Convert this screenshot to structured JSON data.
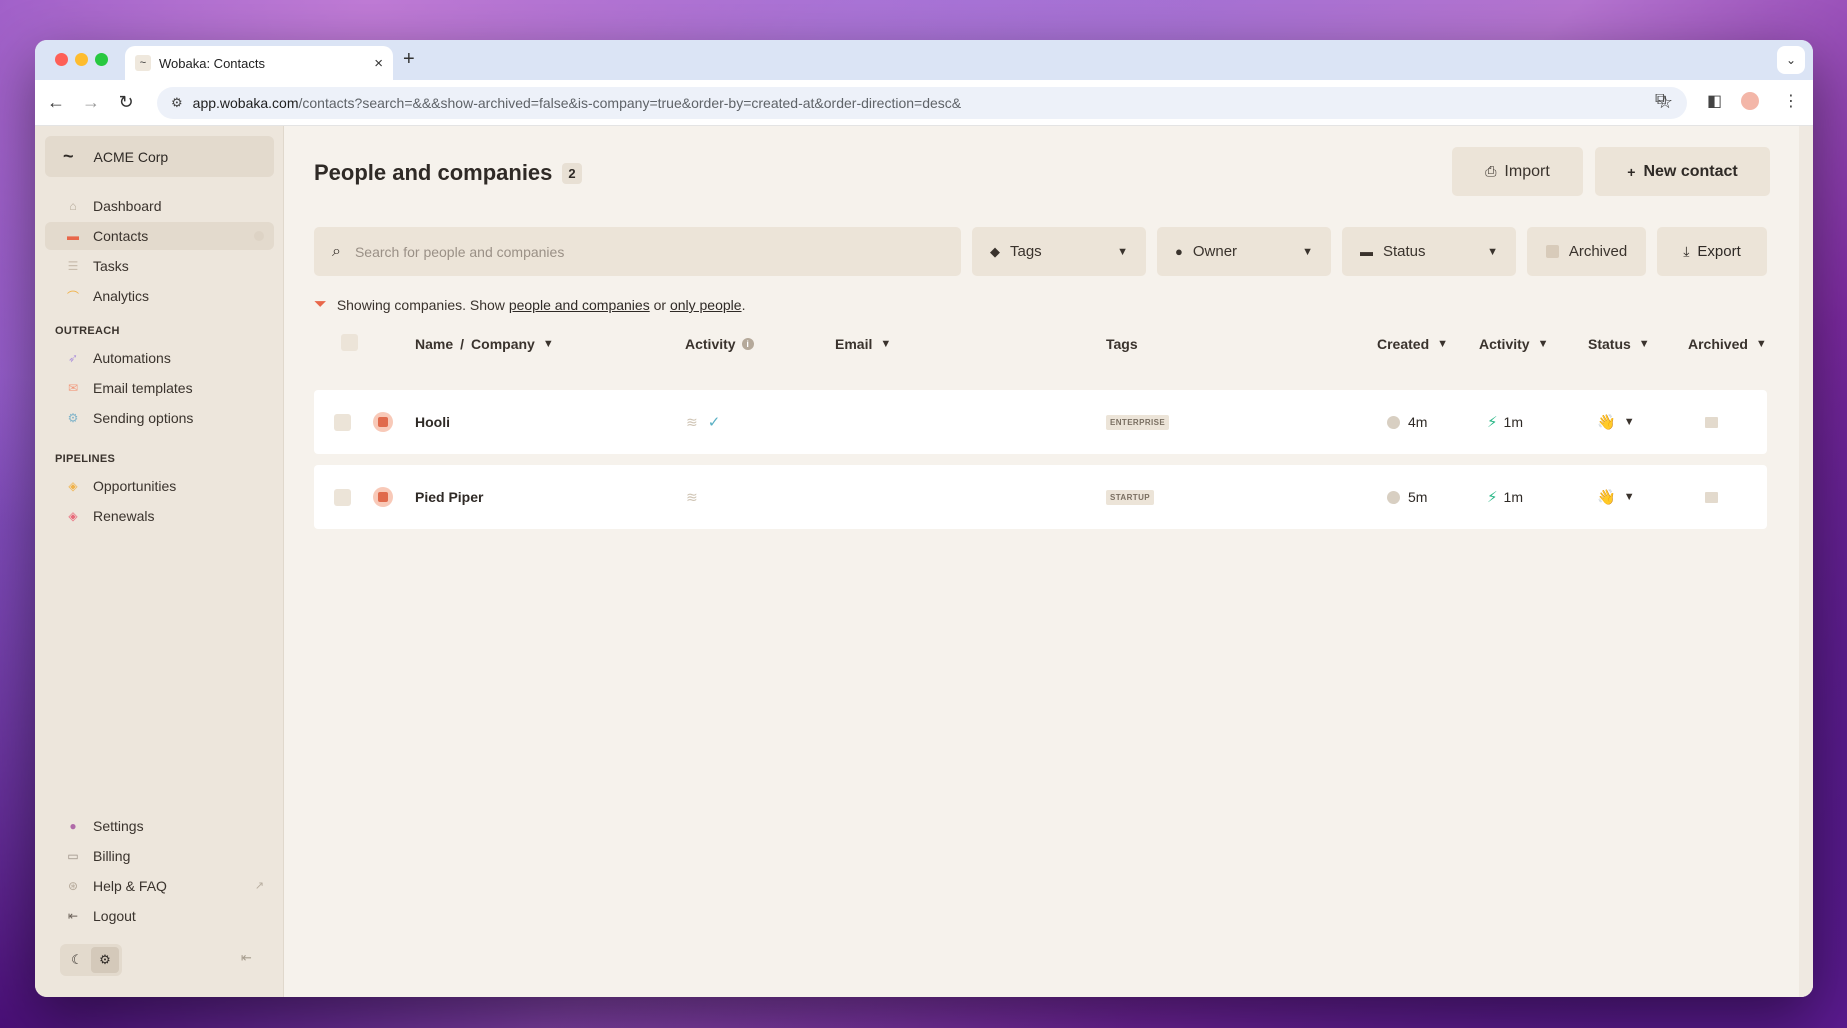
{
  "browser": {
    "tab_title": "Wobaka: Contacts",
    "url_host": "app.wobaka.com",
    "url_path": "/contacts?search=&&&show-archived=false&is-company=true&order-by=created-at&order-direction=desc&"
  },
  "sidebar": {
    "workspace": "ACME Corp",
    "main_items": [
      {
        "label": "Dashboard",
        "icon": "home-icon"
      },
      {
        "label": "Contacts",
        "icon": "contact-card-icon"
      },
      {
        "label": "Tasks",
        "icon": "list-icon"
      },
      {
        "label": "Analytics",
        "icon": "chart-icon"
      }
    ],
    "outreach_title": "OUTREACH",
    "outreach_items": [
      {
        "label": "Automations",
        "icon": "rocket-icon"
      },
      {
        "label": "Email templates",
        "icon": "envelope-icon"
      },
      {
        "label": "Sending options",
        "icon": "gears-icon"
      }
    ],
    "pipelines_title": "PIPELINES",
    "pipeline_items": [
      {
        "label": "Opportunities",
        "icon": "stack-icon"
      },
      {
        "label": "Renewals",
        "icon": "stack-icon"
      }
    ],
    "bottom_items": [
      {
        "label": "Settings",
        "icon": "user-icon"
      },
      {
        "label": "Billing",
        "icon": "card-icon"
      },
      {
        "label": "Help & FAQ",
        "icon": "lifebuoy-icon"
      },
      {
        "label": "Logout",
        "icon": "logout-icon"
      }
    ]
  },
  "main": {
    "title": "People and companies",
    "count": "2",
    "import_label": "Import",
    "new_contact_label": "New contact",
    "search_placeholder": "Search for people and companies",
    "filters": {
      "tags": "Tags",
      "owner": "Owner",
      "status": "Status",
      "archived": "Archived",
      "export": "Export"
    },
    "info": {
      "prefix": "Showing companies. Show ",
      "link_all": "people and companies",
      "middle": " or ",
      "link_people": "only people",
      "suffix": "."
    },
    "columns": {
      "name": "Name",
      "slash": "/",
      "company": "Company",
      "activity": "Activity",
      "email": "Email",
      "tags": "Tags",
      "created": "Created",
      "activity2": "Activity",
      "status": "Status",
      "archived": "Archived"
    },
    "rows": [
      {
        "name": "Hooli",
        "tag": "ENTERPRISE",
        "created": "4m",
        "last_activity": "1m",
        "status_emoji": "👋",
        "has_check": true
      },
      {
        "name": "Pied Piper",
        "tag": "STARTUP",
        "created": "5m",
        "last_activity": "1m",
        "status_emoji": "👋",
        "has_check": false
      }
    ]
  }
}
